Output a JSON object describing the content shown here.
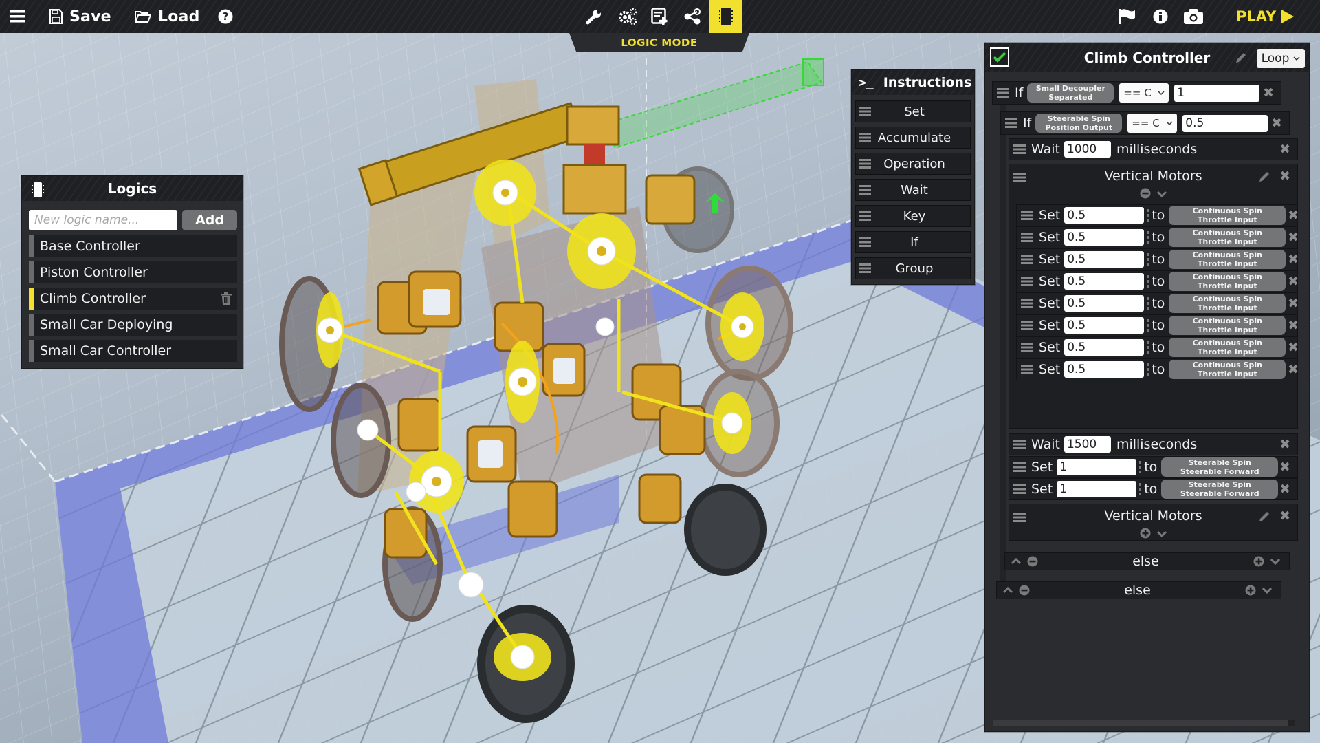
{
  "topbar": {
    "menu_icon": "hamburger-icon",
    "save_label": "Save",
    "load_label": "Load",
    "help_icon": "question-circle-icon",
    "tools": [
      {
        "name": "build",
        "icon": "wrench-icon"
      },
      {
        "name": "mechanics",
        "icon": "gears-icon"
      },
      {
        "name": "add-part",
        "icon": "list-add-icon"
      },
      {
        "name": "share",
        "icon": "share-icon"
      },
      {
        "name": "logic",
        "icon": "chip-icon",
        "active": true
      }
    ],
    "mode_label": "LOGIC MODE",
    "right_icons": [
      "flag-icon",
      "info-icon",
      "camera-icon"
    ],
    "play_label": "PLAY"
  },
  "colors": {
    "accent": "#f1e12e",
    "panel_bg": "#2b2c30",
    "row_bg": "#1e1f22",
    "pill_bg": "#747577",
    "check_green": "#3ec43e",
    "floor_blue": "#7b85d6"
  },
  "logics": {
    "title": "Logics",
    "new_placeholder": "New logic name...",
    "new_value": "",
    "add_label": "Add",
    "items": [
      {
        "label": "Base Controller",
        "active": false
      },
      {
        "label": "Piston Controller",
        "active": false
      },
      {
        "label": "Climb Controller",
        "active": true
      },
      {
        "label": "Small Car Deploying",
        "active": false
      },
      {
        "label": "Small Car Controller",
        "active": false
      }
    ]
  },
  "instructions": {
    "title": "Instructions",
    "prompt": ">_",
    "items": [
      "Set",
      "Accumulate",
      "Operation",
      "Wait",
      "Key",
      "If",
      "Group"
    ]
  },
  "editor": {
    "title": "Climb Controller",
    "enabled": true,
    "mode": "Loop",
    "if1": {
      "keyword": "If",
      "source_line1": "Small Decoupler",
      "source_line2": "Separated",
      "operator": "== C",
      "value": "1"
    },
    "if2": {
      "keyword": "If",
      "source_line1": "Steerable Spin",
      "source_line2": "Position Output",
      "operator": "== C",
      "value": "0.5"
    },
    "wait1": {
      "keyword": "Wait",
      "value": "1000",
      "unit": "milliseconds"
    },
    "group1": {
      "title": "Vertical Motors",
      "collapsed": false,
      "sets": [
        {
          "keyword": "Set",
          "value": "0.5",
          "to": "to",
          "target_line1": "Continuous Spin",
          "target_line2": "Throttle Input"
        },
        {
          "keyword": "Set",
          "value": "0.5",
          "to": "to",
          "target_line1": "Continuous Spin",
          "target_line2": "Throttle Input"
        },
        {
          "keyword": "Set",
          "value": "0.5",
          "to": "to",
          "target_line1": "Continuous Spin",
          "target_line2": "Throttle Input"
        },
        {
          "keyword": "Set",
          "value": "0.5",
          "to": "to",
          "target_line1": "Continuous Spin",
          "target_line2": "Throttle Input"
        },
        {
          "keyword": "Set",
          "value": "0.5",
          "to": "to",
          "target_line1": "Continuous Spin",
          "target_line2": "Throttle Input"
        },
        {
          "keyword": "Set",
          "value": "0.5",
          "to": "to",
          "target_line1": "Continuous Spin",
          "target_line2": "Throttle Input"
        },
        {
          "keyword": "Set",
          "value": "0.5",
          "to": "to",
          "target_line1": "Continuous Spin",
          "target_line2": "Throttle Input"
        },
        {
          "keyword": "Set",
          "value": "0.5",
          "to": "to",
          "target_line1": "Continuous Spin",
          "target_line2": "Throttle Input"
        }
      ]
    },
    "wait2": {
      "keyword": "Wait",
      "value": "1500",
      "unit": "milliseconds"
    },
    "sets2": [
      {
        "keyword": "Set",
        "value": "1",
        "to": "to",
        "target_line1": "Steerable Spin",
        "target_line2": "Steerable Forward"
      },
      {
        "keyword": "Set",
        "value": "1",
        "to": "to",
        "target_line1": "Steerable Spin",
        "target_line2": "Steerable Forward"
      }
    ],
    "group2": {
      "title": "Vertical Motors",
      "collapsed": true
    },
    "else_inner": "else",
    "else_outer": "else"
  }
}
